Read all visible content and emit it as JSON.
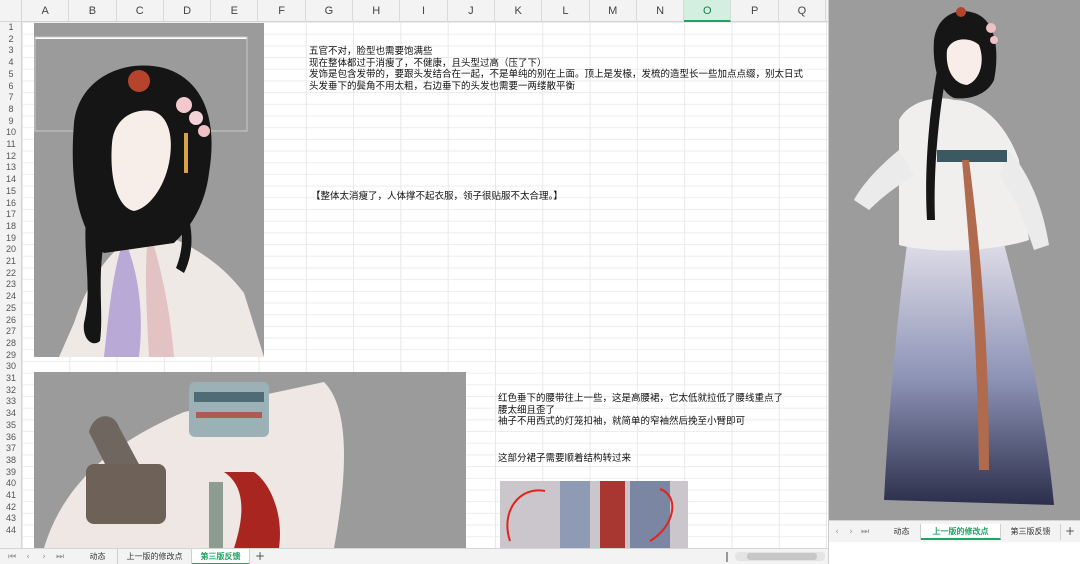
{
  "sheet": {
    "columns": [
      "A",
      "B",
      "C",
      "D",
      "E",
      "F",
      "G",
      "H",
      "I",
      "J",
      "K",
      "L",
      "M",
      "N",
      "O",
      "P",
      "Q"
    ],
    "active_column": "O",
    "rows": [
      "1",
      "2",
      "3",
      "4",
      "5",
      "6",
      "7",
      "8",
      "9",
      "10",
      "11",
      "12",
      "13",
      "14",
      "15",
      "16",
      "17",
      "18",
      "19",
      "20",
      "21",
      "22",
      "23",
      "24",
      "25",
      "26",
      "27",
      "28",
      "29",
      "30",
      "31",
      "32",
      "33",
      "34",
      "35",
      "36",
      "37",
      "38",
      "39",
      "40",
      "41",
      "42",
      "43",
      "44"
    ]
  },
  "notes": {
    "face": [
      "五官不对，脸型也需要饱满些",
      "现在整体都过于消瘦了，不健康，且头型过高（压了下）",
      "发饰是包含发带的，要跟头发结合在一起，不是单纯的别在上面。顶上是发椽，发梳的造型长一些加点点缀，别太日式",
      "头发垂下的鬓角不用太粗，右边垂下的头发也需要一两缕散平衡"
    ],
    "body": "【整体太消瘦了，人体撑不起衣服，领子很贴服不太合理。】",
    "waist": [
      "红色垂下的腰带往上一些，这是高腰裙，它太低就拉低了腰线重点了",
      "腰太细且歪了",
      "袖子不用西式的灯笼扣袖，就简单的窄袖然后挽至小臂即可"
    ],
    "skirt": "这部分裙子需要顺着结构转过来"
  },
  "tabs": {
    "sheets": [
      "动态",
      "上一版的修改点",
      "第三版反馈"
    ],
    "active_index": 2,
    "add_label": "+"
  },
  "right_tabs": {
    "sheets": [
      "动态",
      "上一版的修改点",
      "第三版反馈"
    ],
    "active_index": 1,
    "add_label": "+"
  },
  "icons": {
    "first_sheet": "first-sheet-icon",
    "prev_sheet": "prev-sheet-icon",
    "next_sheet": "next-sheet-icon",
    "last_sheet": "last-sheet-icon"
  },
  "colors": {
    "accent": "#21a366",
    "header_bg": "#f3f3f3",
    "art_bg": "#9b9b9b"
  }
}
